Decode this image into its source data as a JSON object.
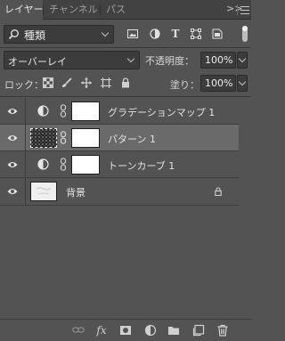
{
  "tabs": [
    {
      "label": "レイヤー",
      "active": true
    },
    {
      "label": "チャンネル",
      "active": false
    },
    {
      "label": "パス",
      "active": false
    }
  ],
  "panel": {
    "collapse_label": ">>",
    "menu_icon": "hamburger-menu-icon"
  },
  "filter": {
    "kind_label": "種類",
    "icons": [
      "search-icon",
      "image-filter-icon",
      "adjustment-filter-icon",
      "type-filter-icon",
      "shape-filter-icon",
      "smart-object-filter-icon"
    ],
    "toggle_on": true
  },
  "blend": {
    "mode": "オーバーレイ",
    "opacity_label": "不透明度：",
    "opacity_value": "100%"
  },
  "lock": {
    "label": "ロック：",
    "icons": [
      "lock-transparent-pixels-icon",
      "lock-image-pixels-icon",
      "lock-position-icon",
      "lock-artboard-icon",
      "lock-all-icon"
    ],
    "fill_label": "塗り：",
    "fill_value": "100%"
  },
  "layers": [
    {
      "name": "グラデーションマップ 1",
      "type": "adjustment",
      "visible": true,
      "selected": false,
      "has_mask": true
    },
    {
      "name": "パターン 1",
      "type": "pattern-fill",
      "visible": true,
      "selected": true,
      "has_mask": true
    },
    {
      "name": "トーンカーブ 1",
      "type": "adjustment",
      "visible": true,
      "selected": false,
      "has_mask": true
    },
    {
      "name": "背景",
      "type": "background",
      "visible": true,
      "selected": false,
      "locked": true
    }
  ],
  "bottom_icons": [
    "link-layers-icon",
    "fx-icon",
    "add-mask-icon",
    "new-adjustment-icon",
    "new-group-icon",
    "new-layer-icon",
    "delete-icon"
  ],
  "bottom": {
    "fx_label": "fx"
  },
  "colors": {
    "panel_bg": "#535353",
    "tabbar_bg": "#424242",
    "field_bg": "#3c3c3c",
    "selected_row": "#6a6a6a",
    "text": "#dcdcdc"
  }
}
